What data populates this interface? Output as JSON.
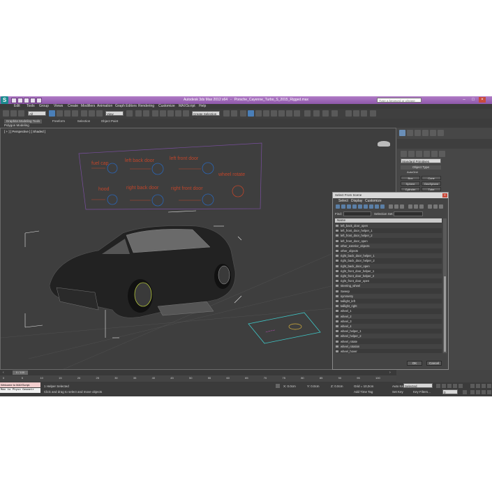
{
  "window": {
    "app": "Autodesk 3ds Max  2012 x64",
    "file": "Porsche_Cayenne_Turbo_S_2015_Rigged.max",
    "search_placeholder": "Type a keyword or phrase"
  },
  "menu": [
    "Edit",
    "Tools",
    "Group",
    "Views",
    "Create",
    "Modifiers",
    "Animation",
    "Graph Editors",
    "Rendering",
    "Customize",
    "MAXScript",
    "Help"
  ],
  "toolbar": {
    "selection_filter": "All",
    "reference": "View",
    "named_selection": "Create Selection Se"
  },
  "ribbon": {
    "tabs": [
      "Graphite Modeling Tools",
      "Freeform",
      "Selection",
      "Object Paint"
    ],
    "sub": "Polygon Modeling"
  },
  "viewport": {
    "label": "[ + ] [ Perspective ] [ Shaded ]",
    "board_labels": [
      "fuel cap",
      "left back door",
      "left front door",
      "wheel rotate",
      "hood",
      "right back door",
      "right front door",
      "trunk"
    ]
  },
  "command_panel": {
    "category": "Standard Primitives",
    "rollout": "Object Type",
    "autogrid": "AutoGrid",
    "primitives": [
      "Box",
      "Cone",
      "Sphere",
      "GeoSphere",
      "Cylinder",
      "Tube",
      "Torus",
      "Pyramid",
      "Teapot",
      "Plane"
    ]
  },
  "dialog": {
    "title": "Select From Scene",
    "menu": [
      "Select",
      "Display",
      "Customize"
    ],
    "find_label": "Find:",
    "selection_set_label": "Selection Set:",
    "column": "Name",
    "items": [
      "left_back_door_open",
      "left_front_door_helper_1",
      "left_front_door_helper_2",
      "left_front_door_open",
      "other_exterior_objects",
      "other_objects",
      "right_back_door_helper_1",
      "right_back_door_helper_2",
      "right_back_door_open",
      "right_front_door_helper_1",
      "right_front_door_helper_2",
      "right_front_door_open",
      "steering_wheel",
      "Sweep",
      "symmetry",
      "taillight_left",
      "taillight_right",
      "wheel_1",
      "wheel_2",
      "wheel_3",
      "wheel_4",
      "wheel_helper_1",
      "wheel_helper_2",
      "wheel_rotate",
      "wheel_rotation",
      "wheel_hover"
    ],
    "ok": "OK",
    "cancel": "Cancel"
  },
  "timeline": {
    "frame": "0 / 100",
    "ticks": [
      "0",
      "5",
      "10",
      "15",
      "20",
      "25",
      "30",
      "35",
      "40",
      "45",
      "50",
      "55",
      "60",
      "65",
      "70",
      "75",
      "80",
      "85",
      "90",
      "95",
      "100"
    ]
  },
  "status": {
    "maxscript_line1": "Welcome to MAXScript.",
    "maxscript_line2": "Max to Physx Geometr",
    "selected": "1 Helper Selected",
    "prompt": "Click and drag to select and move objects",
    "x": "X: 0.0cm",
    "y": "Y: 0.0cm",
    "z": "Z: 0.0cm",
    "grid": "Grid = 10,0cm",
    "autokey": "Auto Key",
    "setkey": "Set Key",
    "selected_combo": "Selected",
    "key_filters": "Key Filters...",
    "add_time_tag": "Add Time Tag",
    "frame_value": "0"
  },
  "colors": {
    "accent": "#8e58aa",
    "board_text": "#c0452a",
    "selection": "#e8e8e8",
    "helper_cyan": "#3fc7c7"
  }
}
